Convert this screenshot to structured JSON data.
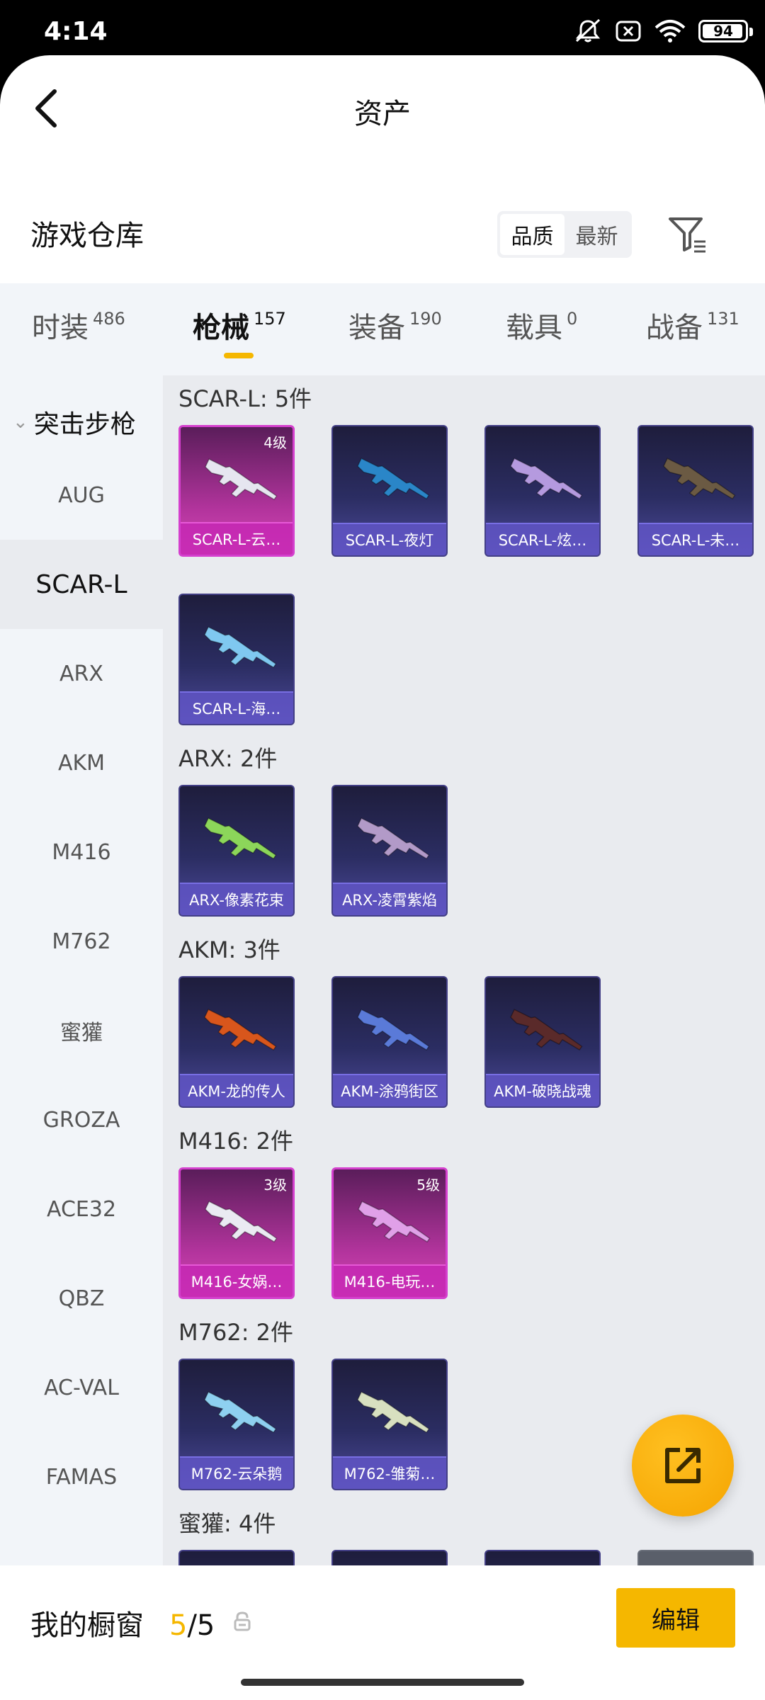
{
  "status": {
    "time": "4:14",
    "battery": "94",
    "battery_level": 0.94
  },
  "header": {
    "title": "资产"
  },
  "warehouse": {
    "title": "游戏仓库",
    "sort_quality": "品质",
    "sort_newest": "最新"
  },
  "tabs": [
    {
      "label": "时装",
      "count": "486"
    },
    {
      "label": "枪械",
      "count": "157"
    },
    {
      "label": "装备",
      "count": "190"
    },
    {
      "label": "载具",
      "count": "0"
    },
    {
      "label": "战备",
      "count": "131"
    }
  ],
  "sidebar": {
    "header": "突击步枪",
    "items": [
      "AUG",
      "SCAR-L",
      "ARX",
      "AKM",
      "M416",
      "M762",
      "蜜獾",
      "GROZA",
      "ACE32",
      "QBZ",
      "AC-VAL",
      "FAMAS"
    ]
  },
  "groups": [
    {
      "title": "SCAR-L: 5件",
      "items": [
        {
          "name": "SCAR-L-云…",
          "level": "4级",
          "rarity": "pink",
          "color": "#e6e6f0"
        },
        {
          "name": "SCAR-L-夜灯",
          "level": "",
          "rarity": "blue",
          "color": "#2a86c8"
        },
        {
          "name": "SCAR-L-炫…",
          "level": "",
          "rarity": "blue",
          "color": "#b59adf"
        },
        {
          "name": "SCAR-L-未…",
          "level": "",
          "rarity": "blue",
          "color": "#6b5a43"
        },
        {
          "name": "SCAR-L-海…",
          "level": "",
          "rarity": "blue",
          "color": "#7fc8f0"
        }
      ]
    },
    {
      "title": "ARX: 2件",
      "items": [
        {
          "name": "ARX-像素花束",
          "level": "",
          "rarity": "blue",
          "color": "#8cd65a"
        },
        {
          "name": "ARX-凌霄紫焰",
          "level": "",
          "rarity": "blue",
          "color": "#b29ac8"
        }
      ]
    },
    {
      "title": "AKM: 3件",
      "items": [
        {
          "name": "AKM-龙的传人",
          "level": "",
          "rarity": "blue",
          "color": "#d8561c"
        },
        {
          "name": "AKM-涂鸦街区",
          "level": "",
          "rarity": "blue",
          "color": "#5a7ad8"
        },
        {
          "name": "AKM-破晓战魂",
          "level": "",
          "rarity": "blue",
          "color": "#5a2a2a"
        }
      ]
    },
    {
      "title": "M416: 2件",
      "items": [
        {
          "name": "M416-女娲…",
          "level": "3级",
          "rarity": "pink",
          "color": "#eaeaf2"
        },
        {
          "name": "M416-电玩…",
          "level": "5级",
          "rarity": "pink",
          "color": "#e0a0e8"
        }
      ]
    },
    {
      "title": "M762: 2件",
      "items": [
        {
          "name": "M762-云朵鹅",
          "level": "",
          "rarity": "blue",
          "color": "#8ed0f0"
        },
        {
          "name": "M762-雏菊…",
          "level": "",
          "rarity": "blue",
          "color": "#d8e0c0"
        }
      ]
    },
    {
      "title": "蜜獾: 4件",
      "items": []
    }
  ],
  "bottom": {
    "my_window": "我的橱窗",
    "used": "5",
    "total": "/5",
    "edit": "编辑"
  }
}
